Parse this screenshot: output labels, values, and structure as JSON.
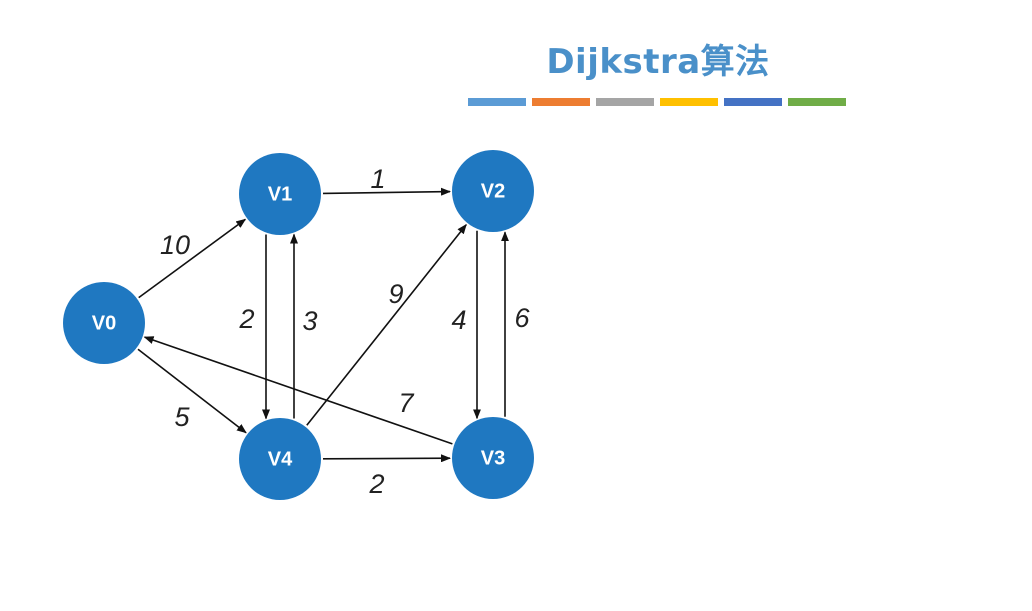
{
  "title": "Dijkstra算法",
  "watermark": "",
  "color_bar": [
    "#5b9bd5",
    "#ed7d31",
    "#a5a5a5",
    "#ffc000",
    "#4472c4",
    "#70ad47"
  ],
  "node_color": "#1f78c1",
  "nodes": [
    {
      "id": "V0",
      "label": "V0"
    },
    {
      "id": "V1",
      "label": "V1"
    },
    {
      "id": "V2",
      "label": "V2"
    },
    {
      "id": "V3",
      "label": "V3"
    },
    {
      "id": "V4",
      "label": "V4"
    }
  ],
  "edges": [
    {
      "from": "V0",
      "to": "V1",
      "weight": "10"
    },
    {
      "from": "V1",
      "to": "V2",
      "weight": "1"
    },
    {
      "from": "V1",
      "to": "V4",
      "weight": "2"
    },
    {
      "from": "V4",
      "to": "V1",
      "weight": "3"
    },
    {
      "from": "V4",
      "to": "V2",
      "weight": "9"
    },
    {
      "from": "V2",
      "to": "V3",
      "weight": "4"
    },
    {
      "from": "V3",
      "to": "V2",
      "weight": "6"
    },
    {
      "from": "V3",
      "to": "V0",
      "weight": "7"
    },
    {
      "from": "V0",
      "to": "V4",
      "weight": "5"
    },
    {
      "from": "V4",
      "to": "V3",
      "weight": "2"
    }
  ]
}
